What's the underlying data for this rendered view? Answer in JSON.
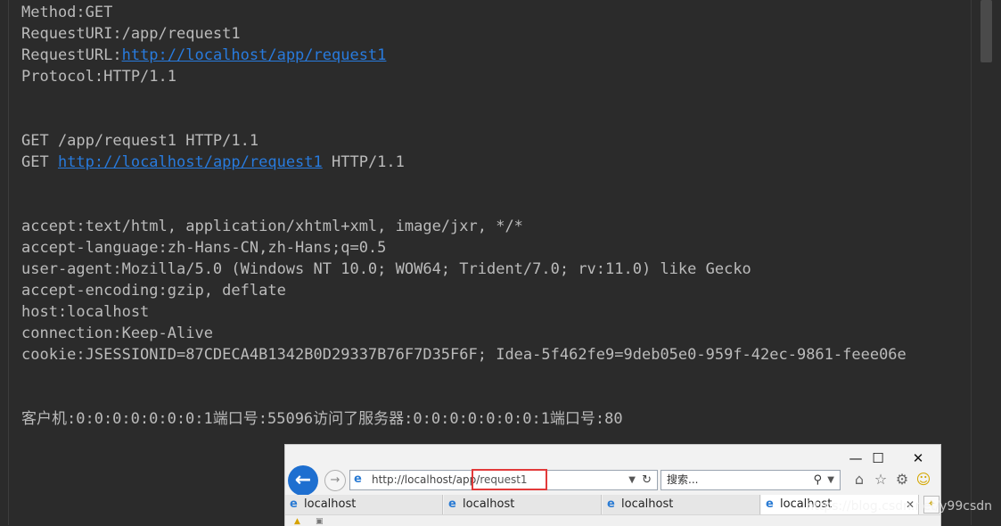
{
  "console": {
    "lines": [
      {
        "text": "Method:GET"
      },
      {
        "text": "RequestURI:/app/request1"
      },
      {
        "prefix": "RequestURL:",
        "link": "http://localhost/app/request1",
        "suffix": ""
      },
      {
        "text": "Protocol:HTTP/1.1"
      },
      {
        "text": ""
      },
      {
        "text": ""
      },
      {
        "text": "GET /app/request1 HTTP/1.1"
      },
      {
        "prefix": "GET ",
        "link": "http://localhost/app/request1",
        "suffix": " HTTP/1.1"
      },
      {
        "text": ""
      },
      {
        "text": ""
      },
      {
        "text": "accept:text/html, application/xhtml+xml, image/jxr, */*"
      },
      {
        "text": "accept-language:zh-Hans-CN,zh-Hans;q=0.5"
      },
      {
        "text": "user-agent:Mozilla/5.0 (Windows NT 10.0; WOW64; Trident/7.0; rv:11.0) like Gecko"
      },
      {
        "text": "accept-encoding:gzip, deflate"
      },
      {
        "text": "host:localhost"
      },
      {
        "text": "connection:Keep-Alive"
      },
      {
        "text": "cookie:JSESSIONID=87CDECA4B1342B0D29337B76F7D35F6F; Idea-5f462fe9=9deb05e0-959f-42ec-9861-feee06e"
      },
      {
        "text": ""
      },
      {
        "text": ""
      },
      {
        "text": "客户机:0:0:0:0:0:0:0:1端口号:55096访问了服务器:0:0:0:0:0:0:0:1端口号:80"
      }
    ]
  },
  "browser": {
    "window_controls": {
      "minimize": "—",
      "maximize": "☐",
      "close": "✕"
    },
    "address": {
      "url_prefix": "http://localhost/app/",
      "url_path": "request1"
    },
    "search": {
      "placeholder": "搜索..."
    },
    "tabs": [
      {
        "label": "localhost",
        "active": false
      },
      {
        "label": "localhost",
        "active": false
      },
      {
        "label": "localhost",
        "active": false
      },
      {
        "label": "localhost",
        "active": true
      }
    ]
  },
  "watermark": "https://blog.csdn.net/y99csdn",
  "colors": {
    "background": "#2b2b2b",
    "text": "#bbbbbb",
    "link": "#287bde",
    "highlight_box": "#e23a3a",
    "ie_blue": "#1e6fd0"
  }
}
